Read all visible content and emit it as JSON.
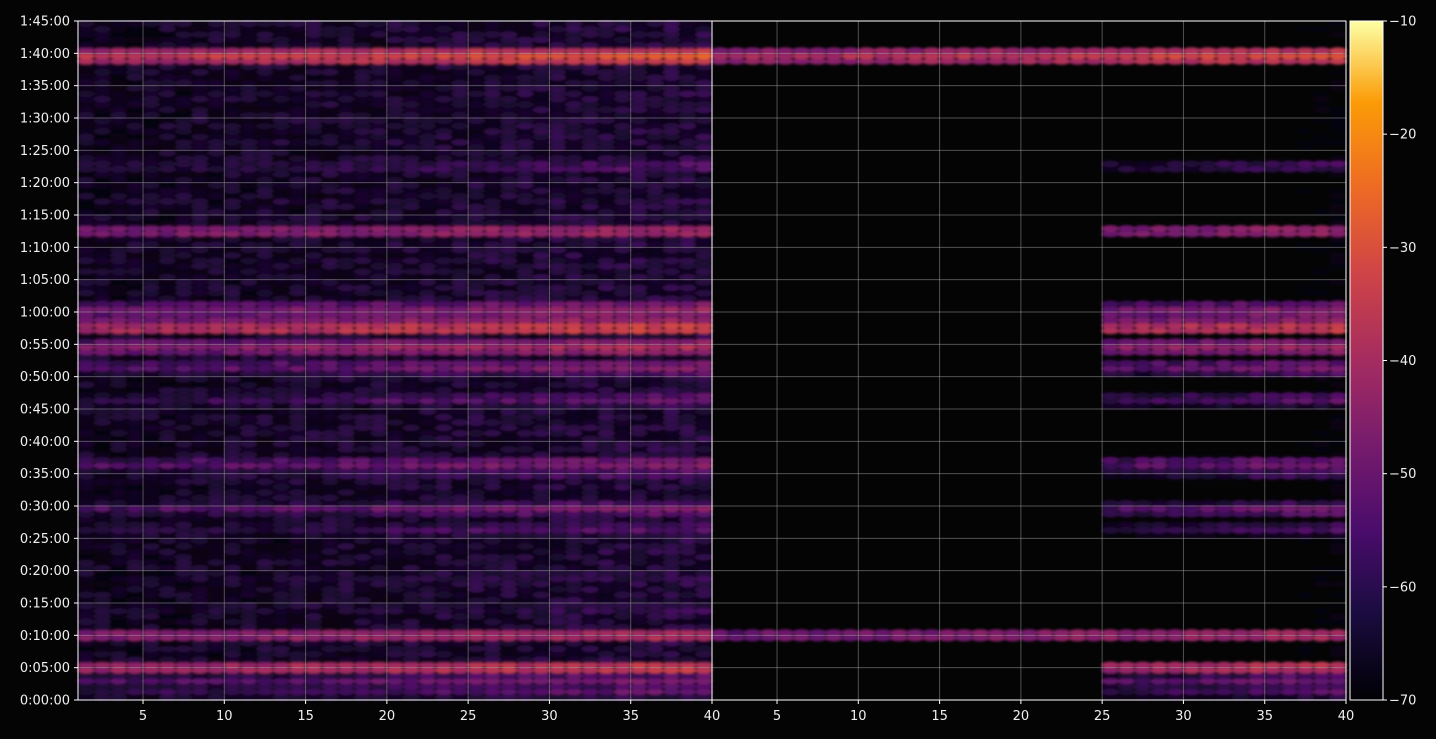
{
  "chart_data": {
    "type": "heatmap",
    "title": "",
    "xlabel": "",
    "ylabel": "",
    "grid": true,
    "colormap": "inferno",
    "panels": [
      {
        "name": "",
        "x_range": [
          1,
          40
        ],
        "x_ticks": [
          5,
          10,
          15,
          20,
          25,
          30,
          35,
          40
        ],
        "features": "energy bands at 0:05, 0:10, 0:55, 1:00, 1:12, 1:22, 1:40; broadband activity across most times"
      },
      {
        "name": "",
        "x_range": [
          1,
          40
        ],
        "x_ticks": [
          5,
          10,
          15,
          20,
          25,
          30,
          35,
          40
        ],
        "features": "mostly dark; energy mainly at x > 25; lines at 0:10 and 1:40 across all x"
      }
    ],
    "y_range_seconds": [
      0,
      6300
    ],
    "y_ticks": [
      "0:00:00",
      "0:05:00",
      "0:10:00",
      "0:15:00",
      "0:20:00",
      "0:25:00",
      "0:30:00",
      "0:35:00",
      "0:40:00",
      "0:45:00",
      "0:50:00",
      "0:55:00",
      "1:00:00",
      "1:05:00",
      "1:10:00",
      "1:15:00",
      "1:20:00",
      "1:25:00",
      "1:30:00",
      "1:35:00",
      "1:40:00",
      "1:45:00"
    ],
    "bands_minutes": [
      {
        "t": 1.5,
        "level": -50,
        "side": "right"
      },
      {
        "t": 3.0,
        "level": -48,
        "side": "right"
      },
      {
        "t": 5.0,
        "level": -34,
        "side": "right"
      },
      {
        "t": 10.0,
        "level": -38,
        "side": "both"
      },
      {
        "t": 14.0,
        "level": -56,
        "side": "left"
      },
      {
        "t": 19.0,
        "level": -56,
        "side": "left"
      },
      {
        "t": 26.5,
        "level": -52,
        "side": "right"
      },
      {
        "t": 29.5,
        "level": -48,
        "side": "right"
      },
      {
        "t": 35.0,
        "level": -52,
        "side": "right"
      },
      {
        "t": 36.5,
        "level": -46,
        "side": "right"
      },
      {
        "t": 46.5,
        "level": -50,
        "side": "right"
      },
      {
        "t": 51.5,
        "level": -46,
        "side": "right"
      },
      {
        "t": 54.5,
        "level": -40,
        "side": "right"
      },
      {
        "t": 57.5,
        "level": -32,
        "side": "right"
      },
      {
        "t": 59.0,
        "level": -42,
        "side": "right"
      },
      {
        "t": 60.5,
        "level": -44,
        "side": "right"
      },
      {
        "t": 72.5,
        "level": -40,
        "side": "right"
      },
      {
        "t": 82.5,
        "level": -52,
        "side": "right"
      },
      {
        "t": 99.5,
        "level": -30,
        "side": "both"
      }
    ],
    "colorbar": {
      "min": -70,
      "max": -10,
      "ticks": [
        "−70",
        "−60",
        "−50",
        "−40",
        "−30",
        "−20",
        "−10"
      ]
    }
  }
}
